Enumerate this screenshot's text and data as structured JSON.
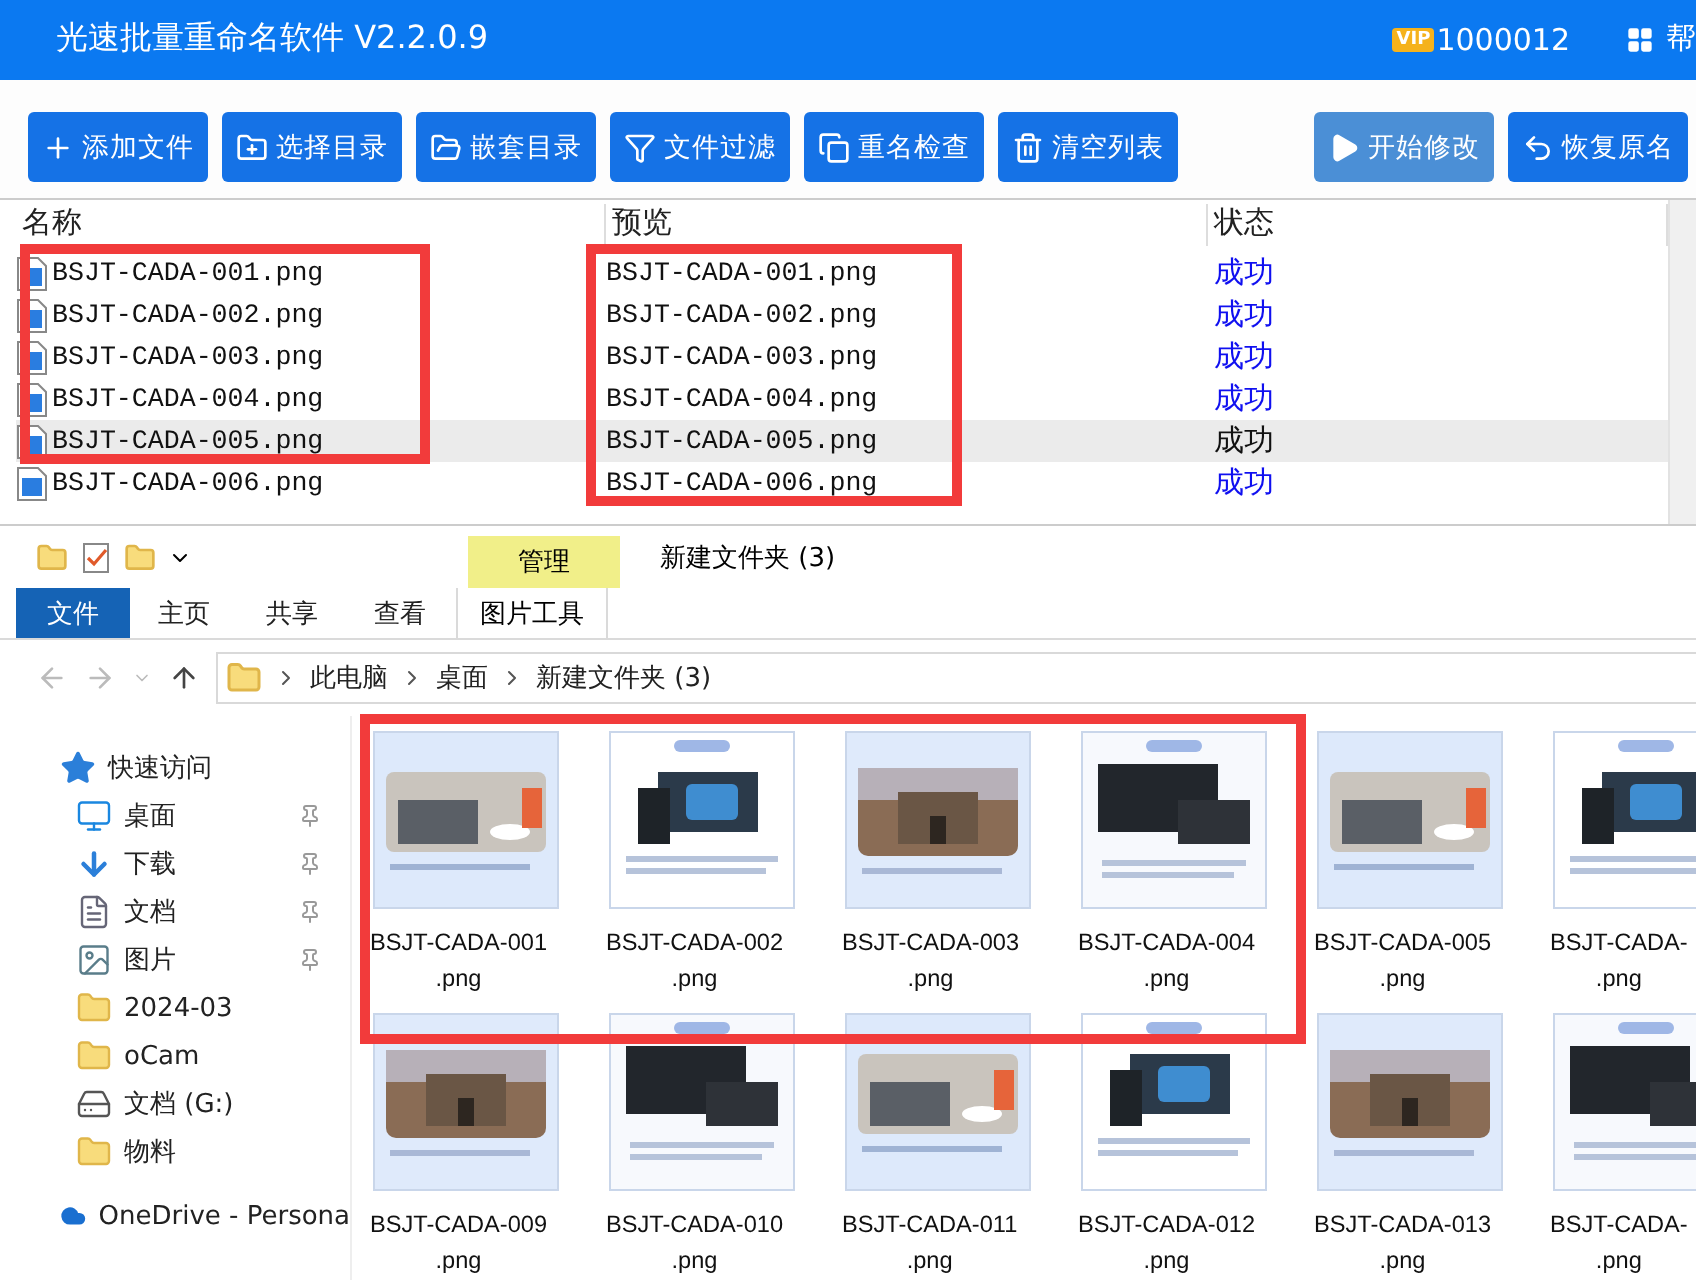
{
  "app": {
    "title": "光速批量重命名软件 V2.2.0.9",
    "vip_badge": "VIP",
    "user_id": "1000012",
    "help": "帮"
  },
  "toolbar": [
    {
      "label": "添加文件",
      "disabled": false
    },
    {
      "label": "选择目录",
      "disabled": false
    },
    {
      "label": "嵌套目录",
      "disabled": false
    },
    {
      "label": "文件过滤",
      "disabled": false
    },
    {
      "label": "重名检查",
      "disabled": false
    },
    {
      "label": "清空列表",
      "disabled": false
    }
  ],
  "actions": [
    {
      "label": "开始修改",
      "disabled": true
    },
    {
      "label": "恢复原名",
      "disabled": false
    }
  ],
  "table": {
    "columns": [
      "名称",
      "预览",
      "状态"
    ],
    "rows": [
      {
        "name": "BSJT-CADA-001.png",
        "preview": "BSJT-CADA-001.png",
        "status": "成功",
        "selected": false
      },
      {
        "name": "BSJT-CADA-002.png",
        "preview": "BSJT-CADA-002.png",
        "status": "成功",
        "selected": false
      },
      {
        "name": "BSJT-CADA-003.png",
        "preview": "BSJT-CADA-003.png",
        "status": "成功",
        "selected": false
      },
      {
        "name": "BSJT-CADA-004.png",
        "preview": "BSJT-CADA-004.png",
        "status": "成功",
        "selected": false
      },
      {
        "name": "BSJT-CADA-005.png",
        "preview": "BSJT-CADA-005.png",
        "status": "成功",
        "selected": true
      },
      {
        "name": "BSJT-CADA-006.png",
        "preview": "BSJT-CADA-006.png",
        "status": "成功",
        "selected": false
      }
    ]
  },
  "explorer": {
    "title": "新建文件夹 (3)",
    "context_group": "管理",
    "ribbon_tabs": [
      {
        "label": "文件",
        "selected": true
      },
      {
        "label": "主页",
        "selected": false
      },
      {
        "label": "共享",
        "selected": false
      },
      {
        "label": "查看",
        "selected": false
      }
    ],
    "context_tab": "图片工具",
    "breadcrumb": [
      "此电脑",
      "桌面",
      "新建文件夹 (3)"
    ],
    "nav": [
      {
        "label": "快速访问",
        "kind": "quick_access",
        "pinned": false
      },
      {
        "label": "桌面",
        "kind": "desktop",
        "pinned": true
      },
      {
        "label": "下载",
        "kind": "download",
        "pinned": true
      },
      {
        "label": "文档",
        "kind": "document",
        "pinned": true
      },
      {
        "label": "图片",
        "kind": "pictures",
        "pinned": true
      },
      {
        "label": "2024-03",
        "kind": "folder",
        "pinned": false
      },
      {
        "label": "oCam",
        "kind": "folder",
        "pinned": false
      },
      {
        "label": "文档 (G:)",
        "kind": "drive",
        "pinned": false
      },
      {
        "label": "物料",
        "kind": "folder",
        "pinned": false
      },
      {
        "label": "OneDrive - Persona",
        "kind": "cloud",
        "pinned": false
      }
    ],
    "files": [
      {
        "name": "BSJT-CADA-001",
        "ext": ".png"
      },
      {
        "name": "BSJT-CADA-002",
        "ext": ".png"
      },
      {
        "name": "BSJT-CADA-003",
        "ext": ".png"
      },
      {
        "name": "BSJT-CADA-004",
        "ext": ".png"
      },
      {
        "name": "BSJT-CADA-005",
        "ext": ".png"
      },
      {
        "name": "BSJT-CADA-",
        "ext": ".png"
      },
      {
        "name": "BSJT-CADA-009",
        "ext": ".png"
      },
      {
        "name": "BSJT-CADA-010",
        "ext": ".png"
      },
      {
        "name": "BSJT-CADA-011",
        "ext": ".png"
      },
      {
        "name": "BSJT-CADA-012",
        "ext": ".png"
      },
      {
        "name": "BSJT-CADA-013",
        "ext": ".png"
      },
      {
        "name": "BSJT-CADA-",
        "ext": ".png"
      }
    ]
  }
}
